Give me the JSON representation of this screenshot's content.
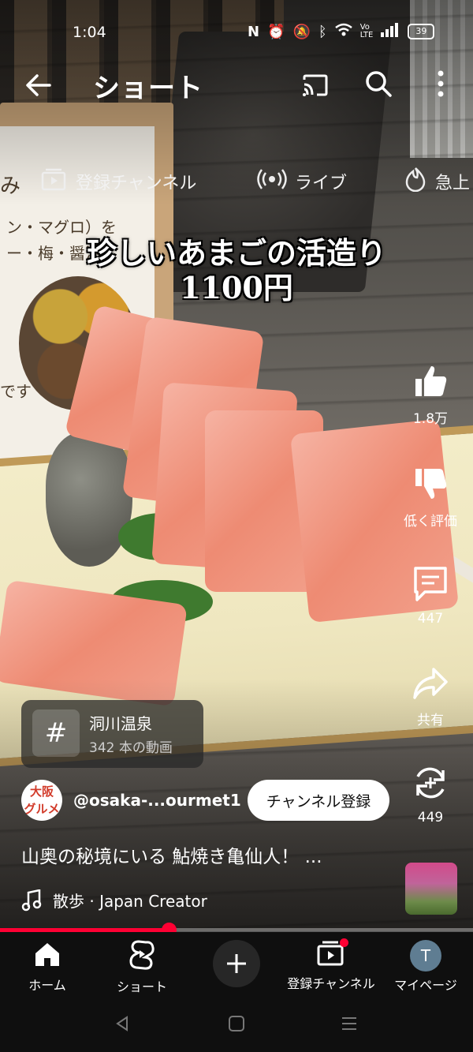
{
  "status_bar": {
    "time": "1:04",
    "battery": "39",
    "icons": [
      "nfc-icon",
      "alarm-icon",
      "mute-icon",
      "bluetooth-icon",
      "wifi-icon",
      "volte-icon",
      "signal-icon"
    ]
  },
  "header": {
    "title": "ショート",
    "icons": [
      "back-arrow-icon",
      "cast-icon",
      "search-icon",
      "more-vert-icon"
    ]
  },
  "chips": [
    {
      "label": "登録チャンネル",
      "icon": "subscriptions-icon"
    },
    {
      "label": "ライブ",
      "icon": "live-icon"
    },
    {
      "label": "急上",
      "icon": "trending-icon"
    }
  ],
  "video": {
    "caption_line1": "珍しいあまごの活造り",
    "caption_line2": "1100円",
    "sign_lines": [
      "み",
      "ン・マグロ）を",
      "ー・梅・醤油",
      "です"
    ]
  },
  "actions": {
    "like_count": "1.8万",
    "dislike_label": "低く評価",
    "comment_count": "447",
    "share_label": "共有",
    "remix_count": "449"
  },
  "hashtag": {
    "title": "洞川温泉",
    "subtitle": "342 本の動画"
  },
  "channel": {
    "avatar_line1": "大阪",
    "avatar_line2": "グルメ",
    "handle": "@osaka-...ourmet1",
    "subscribe_label": "チャンネル登録"
  },
  "description": "山奥の秘境にいる 鮎焼き亀仙人！ ...",
  "music": "散歩 · Japan Creator",
  "progress": {
    "fraction": 0.357
  },
  "bottom_nav": {
    "home": "ホーム",
    "shorts": "ショート",
    "subscriptions": "登録チャンネル",
    "me": "マイページ",
    "me_initial": "T"
  },
  "colors": {
    "accent": "#ff0033",
    "nav_bg": "#0f0f0f"
  }
}
